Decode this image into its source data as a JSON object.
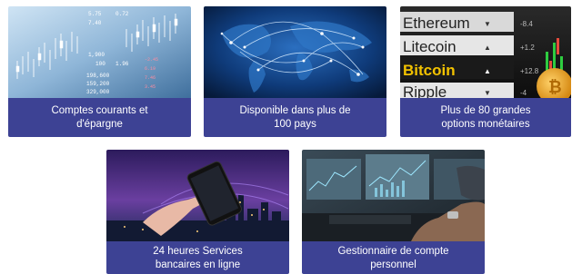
{
  "cards": [
    {
      "caption_l1": "Comptes courants et",
      "caption_l2": "d'épargne",
      "image": "stock-ticker-board"
    },
    {
      "caption_l1": "Disponible dans plus de",
      "caption_l2": "100 pays",
      "image": "world-network-map"
    },
    {
      "caption_l1": "Plus de 80 grandes",
      "caption_l2": "options monétaires",
      "image": "crypto-ticker",
      "ticker": [
        {
          "name": "Ethereum",
          "change": "-8.4"
        },
        {
          "name": "Litecoin",
          "change": "+1.2"
        },
        {
          "name": "Bitcoin",
          "change": "+12.8"
        },
        {
          "name": "Ripple",
          "change": "-4"
        }
      ]
    },
    {
      "caption_l1": "24 heures Services",
      "caption_l2": "bancaires en ligne",
      "image": "hand-phone-city"
    },
    {
      "caption_l1": "Gestionnaire de compte",
      "caption_l2": "personnel",
      "image": "trader-monitors"
    }
  ],
  "ticker_numbers": [
    "198,600",
    "159,200",
    "329,000",
    "1,900",
    "100",
    "5.75",
    "0.72",
    "7.40",
    "1.96"
  ],
  "colors": {
    "caption_bg": "#3d4294",
    "caption_text": "#ffffff"
  }
}
